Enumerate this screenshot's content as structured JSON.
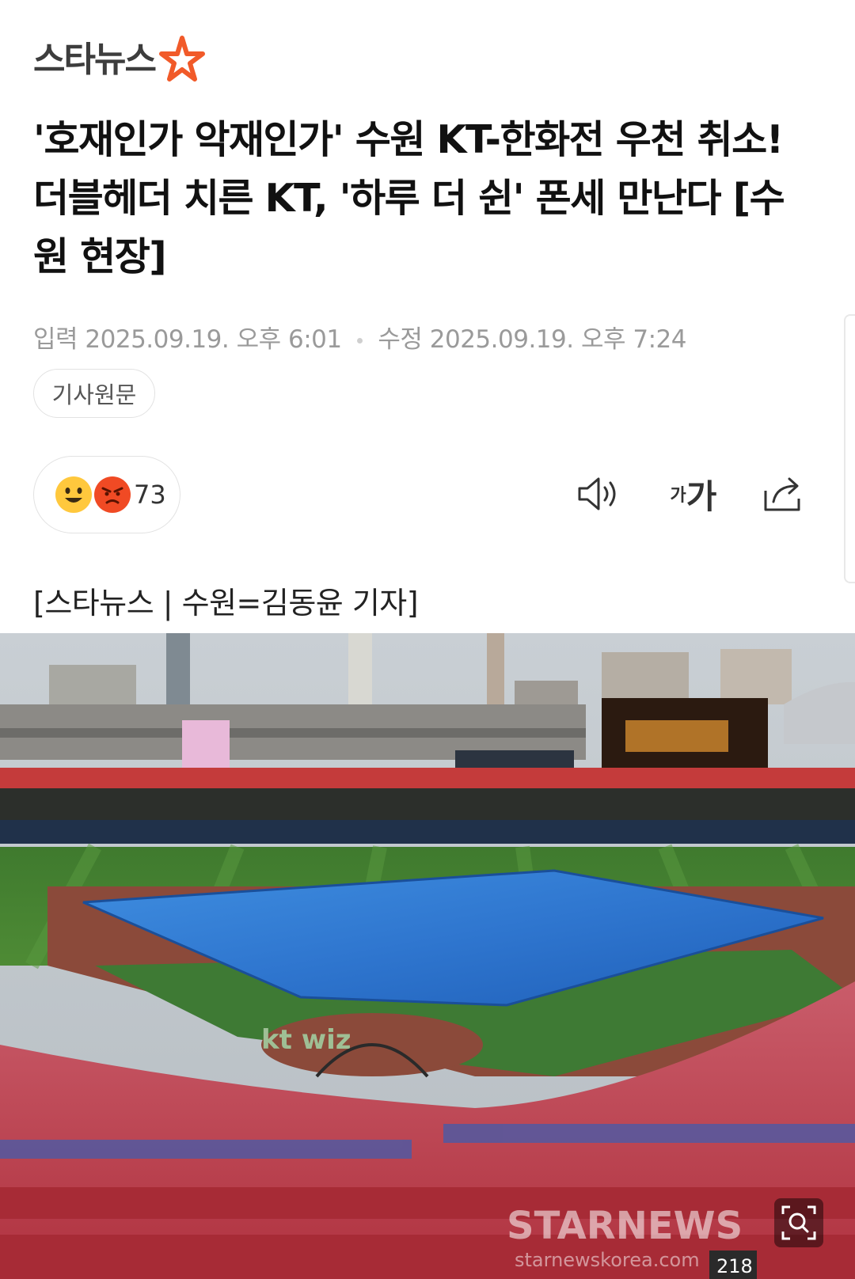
{
  "header": {
    "logo_text": "스타뉴스",
    "logo_star_color": "#f15a29"
  },
  "article": {
    "headline": "'호재인가 악재인가' 수원 KT-한화전 우천 취소! 더블헤더 치른 KT, '하루 더 쉰' 폰세 만난다 [수원 현장]",
    "published_label": "입력",
    "published_time": "2025.09.19. 오후 6:01",
    "modified_label": "수정",
    "modified_time": "2025.09.19. 오후 7:24",
    "original_button": "기사원문",
    "byline": "[스타뉴스 | 수원=김동윤 기자]"
  },
  "reactions": {
    "count": "73",
    "icons": [
      "happy-emoji-icon",
      "angry-emoji-icon"
    ]
  },
  "toolbar": {
    "font_small": "가",
    "font_big": "가",
    "icons": [
      "speaker-icon",
      "font-size-icon",
      "share-icon"
    ]
  },
  "photo": {
    "watermark": "STARNEWS",
    "watermark_url": "starnewskorea.com",
    "section_label": "218"
  }
}
